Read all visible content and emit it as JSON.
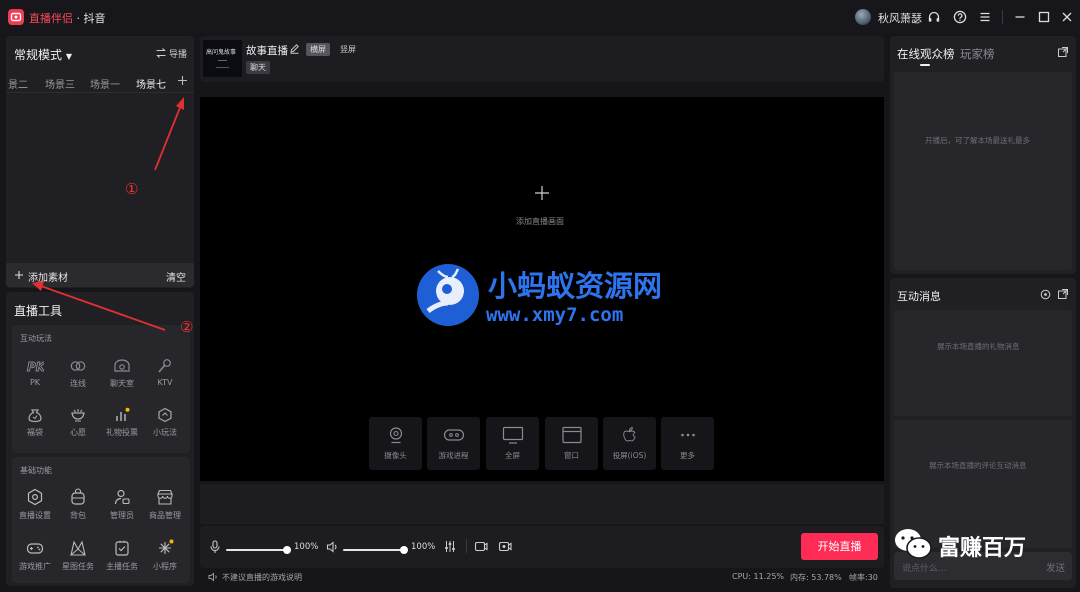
{
  "titlebar": {
    "app_name": "直播伴侣",
    "separator_platform": " · 抖音",
    "user_name": "秋风萧瑟"
  },
  "left_panel": {
    "mode": "常规模式",
    "guide_label": "导播",
    "scene_tabs": [
      "景二",
      "场景三",
      "场景一",
      "场景七"
    ],
    "active_scene": "场景七",
    "add_material": "添加素材",
    "clear": "清空"
  },
  "tools": {
    "title": "直播工具",
    "interactive": {
      "title": "互动玩法",
      "items": [
        {
          "label": "PK",
          "icon": "pk-icon"
        },
        {
          "label": "连线",
          "icon": "link-icon"
        },
        {
          "label": "聊天室",
          "icon": "chatroom-icon"
        },
        {
          "label": "KTV",
          "icon": "microphone-icon"
        },
        {
          "label": "福袋",
          "icon": "lucky-bag-icon"
        },
        {
          "label": "心愿",
          "icon": "wish-icon"
        },
        {
          "label": "礼物投票",
          "icon": "gift-vote-icon"
        },
        {
          "label": "小玩法",
          "icon": "mini-game-icon"
        }
      ]
    },
    "basic": {
      "title": "基础功能",
      "items": [
        {
          "label": "直播设置",
          "icon": "settings-hex-icon"
        },
        {
          "label": "背包",
          "icon": "backpack-icon"
        },
        {
          "label": "管理员",
          "icon": "admin-icon"
        },
        {
          "label": "商品管理",
          "icon": "store-icon"
        },
        {
          "label": "游戏推广",
          "icon": "gamepad-icon"
        },
        {
          "label": "星图任务",
          "icon": "star-map-icon"
        },
        {
          "label": "主播任务",
          "icon": "task-icon"
        },
        {
          "label": "小程序",
          "icon": "mini-program-icon"
        }
      ]
    }
  },
  "stream_header": {
    "thumbnail_text": "高问鬼故事",
    "title": "故事直播",
    "orientation_tabs": [
      "横屏",
      "竖屏"
    ],
    "category": "聊天"
  },
  "preview": {
    "add_scene_label": "添加直播画面",
    "watermark_cn": "小蚂蚁资源网",
    "watermark_url": "www.xmy7.com",
    "sources": [
      {
        "label": "摄像头",
        "icon": "camera-icon"
      },
      {
        "label": "游戏进程",
        "icon": "game-process-icon"
      },
      {
        "label": "全屏",
        "icon": "fullscreen-monitor-icon"
      },
      {
        "label": "窗口",
        "icon": "window-icon"
      },
      {
        "label": "投屏(iOS)",
        "icon": "apple-icon"
      },
      {
        "label": "更多",
        "icon": "more-dots-icon"
      }
    ]
  },
  "controls": {
    "mic_volume": "100%",
    "speaker_volume": "100%",
    "mic_level": 1.0,
    "speaker_level": 1.0,
    "start_button": "开始直播"
  },
  "status": {
    "hint": "不建议直播的游戏说明",
    "cpu": "CPU: 11.25%",
    "memory": "内存: 53.78%",
    "framerate": "帧率:30"
  },
  "right_panel": {
    "tabs": [
      "在线观众榜",
      "玩家榜"
    ],
    "audience_empty": "开播后，可了解本场最送礼最多",
    "messages_title": "互动消息",
    "gift_empty": "展示本场直播的礼物消息",
    "comment_empty": "展示本场直播的评论互动消息",
    "input_placeholder": "说点什么...",
    "send": "发送"
  },
  "overlay": {
    "wechat_brand": "富赚百万",
    "annotation_1": "①",
    "annotation_2": "②"
  },
  "colors": {
    "accent": "#fe2c55",
    "annotation_red": "#e03030",
    "background": "#16161a",
    "panel": "#202024"
  }
}
